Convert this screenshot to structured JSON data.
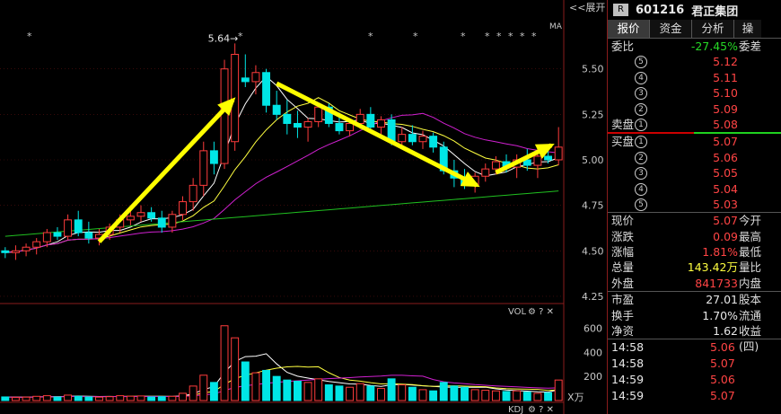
{
  "toolbar": {
    "expand_label": "<<展开",
    "ma_label": "MA"
  },
  "chart_data": {
    "type": "candlestick",
    "y_ticks": [
      "5.50",
      "5.25",
      "5.00",
      "4.75",
      "4.50",
      "4.25"
    ],
    "ylim": [
      4.22,
      5.78
    ],
    "peak_label": "5.64",
    "volume_ticks": [
      "600",
      "400",
      "200"
    ],
    "volume_unit": "X万",
    "vol_label": "VOL",
    "kdj_label": "KDJ",
    "candles": [
      [
        4.5,
        4.52,
        4.46,
        4.49
      ],
      [
        4.49,
        4.53,
        4.45,
        4.5
      ],
      [
        4.5,
        4.54,
        4.47,
        4.52
      ],
      [
        4.52,
        4.57,
        4.48,
        4.55
      ],
      [
        4.55,
        4.62,
        4.52,
        4.6
      ],
      [
        4.6,
        4.63,
        4.56,
        4.58
      ],
      [
        4.58,
        4.7,
        4.56,
        4.67
      ],
      [
        4.67,
        4.72,
        4.58,
        4.6
      ],
      [
        4.6,
        4.66,
        4.54,
        4.57
      ],
      [
        4.57,
        4.62,
        4.53,
        4.59
      ],
      [
        4.59,
        4.65,
        4.56,
        4.63
      ],
      [
        4.63,
        4.7,
        4.6,
        4.67
      ],
      [
        4.67,
        4.72,
        4.64,
        4.69
      ],
      [
        4.69,
        4.75,
        4.66,
        4.71
      ],
      [
        4.71,
        4.74,
        4.66,
        4.68
      ],
      [
        4.68,
        4.72,
        4.6,
        4.63
      ],
      [
        4.63,
        4.72,
        4.6,
        4.7
      ],
      [
        4.7,
        4.8,
        4.67,
        4.77
      ],
      [
        4.77,
        4.9,
        4.72,
        4.86
      ],
      [
        4.86,
        5.1,
        4.8,
        5.05
      ],
      [
        5.05,
        5.1,
        4.92,
        4.98
      ],
      [
        4.98,
        5.55,
        4.95,
        5.5
      ],
      [
        5.1,
        5.64,
        5.05,
        5.58
      ],
      [
        5.45,
        5.58,
        5.4,
        5.43
      ],
      [
        5.43,
        5.52,
        5.36,
        5.48
      ],
      [
        5.48,
        5.5,
        5.26,
        5.3
      ],
      [
        5.3,
        5.38,
        5.22,
        5.25
      ],
      [
        5.25,
        5.33,
        5.14,
        5.2
      ],
      [
        5.2,
        5.27,
        5.12,
        5.18
      ],
      [
        5.18,
        5.23,
        5.1,
        5.21
      ],
      [
        5.21,
        5.31,
        5.18,
        5.29
      ],
      [
        5.29,
        5.31,
        5.18,
        5.2
      ],
      [
        5.2,
        5.26,
        5.14,
        5.16
      ],
      [
        5.16,
        5.22,
        5.13,
        5.2
      ],
      [
        5.2,
        5.28,
        5.17,
        5.25
      ],
      [
        5.25,
        5.29,
        5.16,
        5.18
      ],
      [
        5.18,
        5.24,
        5.14,
        5.22
      ],
      [
        5.22,
        5.25,
        5.08,
        5.1
      ],
      [
        5.1,
        5.18,
        5.06,
        5.14
      ],
      [
        5.14,
        5.19,
        5.08,
        5.1
      ],
      [
        5.1,
        5.16,
        5.06,
        5.13
      ],
      [
        5.13,
        5.15,
        5.04,
        5.07
      ],
      [
        5.07,
        5.1,
        4.92,
        4.94
      ],
      [
        4.94,
        5.0,
        4.85,
        4.9
      ],
      [
        4.9,
        4.95,
        4.84,
        4.86
      ],
      [
        4.86,
        4.93,
        4.82,
        4.91
      ],
      [
        4.91,
        4.98,
        4.88,
        4.95
      ],
      [
        4.95,
        5.02,
        4.92,
        4.99
      ],
      [
        4.99,
        5.03,
        4.93,
        4.96
      ],
      [
        4.96,
        5.03,
        4.9,
        5.0
      ],
      [
        5.0,
        5.06,
        4.94,
        4.97
      ],
      [
        4.97,
        5.04,
        4.9,
        5.02
      ],
      [
        5.02,
        5.07,
        4.98,
        5.0
      ],
      [
        5.0,
        5.18,
        4.97,
        5.07
      ]
    ],
    "volumes": [
      30,
      25,
      28,
      35,
      40,
      30,
      45,
      35,
      30,
      28,
      32,
      40,
      36,
      38,
      30,
      32,
      35,
      60,
      120,
      210,
      150,
      620,
      520,
      320,
      230,
      250,
      200,
      170,
      160,
      150,
      180,
      130,
      120,
      110,
      140,
      120,
      100,
      180,
      130,
      110,
      90,
      80,
      150,
      120,
      110,
      90,
      85,
      80,
      75,
      80,
      70,
      60,
      65,
      170
    ]
  },
  "right_panel": {
    "badge": "R",
    "code": "601216",
    "name": "君正集团",
    "tabs": [
      "报价",
      "资金",
      "分析",
      "操"
    ],
    "weibi": {
      "label": "委比",
      "value": "-27.45%",
      "label2": "委差"
    },
    "sell_levels": [
      {
        "num": "5",
        "price": "5.12"
      },
      {
        "num": "4",
        "price": "5.11"
      },
      {
        "num": "3",
        "price": "5.10"
      },
      {
        "num": "2",
        "price": "5.09"
      },
      {
        "num": "1",
        "prefix": "卖盘",
        "price": "5.08"
      }
    ],
    "buy_levels": [
      {
        "num": "1",
        "prefix": "买盘",
        "price": "5.07"
      },
      {
        "num": "2",
        "price": "5.06"
      },
      {
        "num": "3",
        "price": "5.05"
      },
      {
        "num": "4",
        "price": "5.04"
      },
      {
        "num": "5",
        "price": "5.03"
      }
    ],
    "stats": [
      {
        "l1": "现价",
        "v": "5.07",
        "c": "red",
        "l2": "今开"
      },
      {
        "l1": "涨跌",
        "v": "0.09",
        "c": "red",
        "l2": "最高"
      },
      {
        "l1": "涨幅",
        "v": "1.81%",
        "c": "red",
        "l2": "最低"
      },
      {
        "l1": "总量",
        "v": "143.42万",
        "c": "yellow",
        "l2": "量比"
      },
      {
        "l1": "外盘",
        "v": "841733",
        "c": "red",
        "l2": "内盘"
      }
    ],
    "stats2": [
      {
        "l1": "市盈",
        "v": "27.01",
        "c": "white",
        "l2": "股本"
      },
      {
        "l1": "换手",
        "v": "1.70%",
        "c": "white",
        "l2": "流通"
      },
      {
        "l1": "净资",
        "v": "1.62",
        "c": "white",
        "l2": "收益(四)"
      }
    ],
    "ticks": [
      {
        "time": "14:58",
        "price": "5.06"
      },
      {
        "time": "14:58",
        "price": "5.07"
      },
      {
        "time": "14:59",
        "price": "5.06"
      },
      {
        "time": "14:59",
        "price": "5.07"
      }
    ]
  }
}
